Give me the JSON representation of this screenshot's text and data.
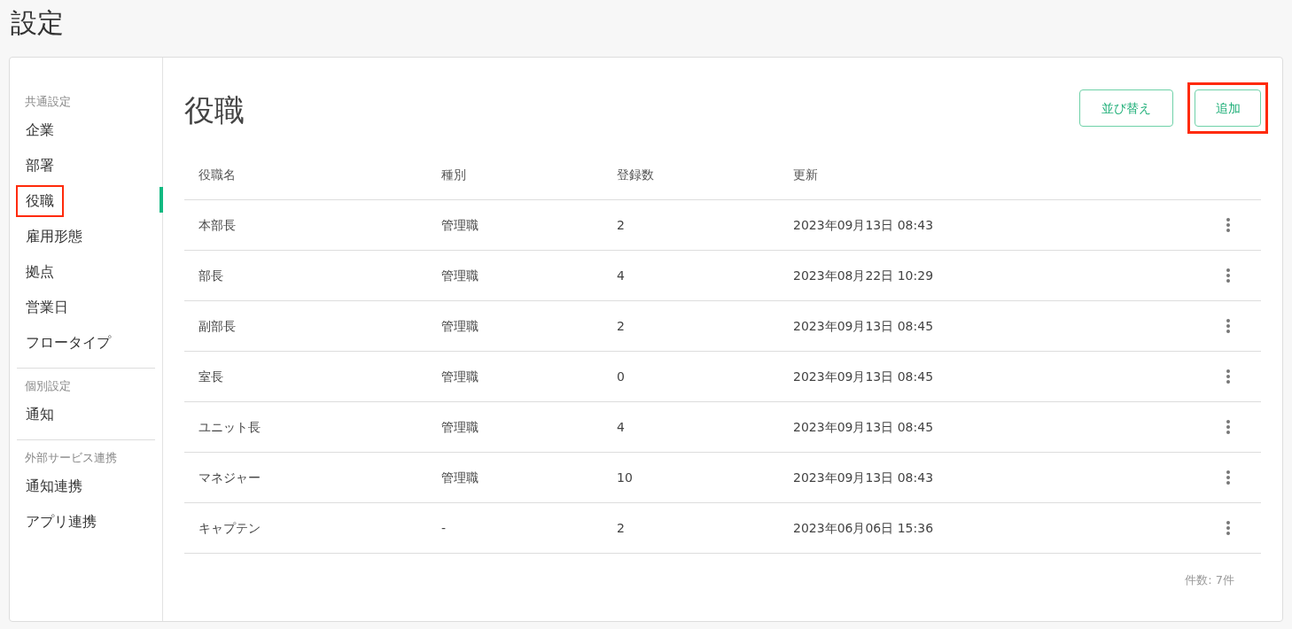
{
  "page_title": "設定",
  "sidebar": {
    "sections": [
      {
        "heading": "共通設定",
        "items": [
          {
            "label": "企業",
            "selected": false,
            "highlighted": false
          },
          {
            "label": "部署",
            "selected": false,
            "highlighted": false
          },
          {
            "label": "役職",
            "selected": true,
            "highlighted": true
          },
          {
            "label": "雇用形態",
            "selected": false,
            "highlighted": false
          },
          {
            "label": "拠点",
            "selected": false,
            "highlighted": false
          },
          {
            "label": "営業日",
            "selected": false,
            "highlighted": false
          },
          {
            "label": "フロータイプ",
            "selected": false,
            "highlighted": false
          }
        ]
      },
      {
        "heading": "個別設定",
        "items": [
          {
            "label": "通知",
            "selected": false,
            "highlighted": false
          }
        ]
      },
      {
        "heading": "外部サービス連携",
        "items": [
          {
            "label": "通知連携",
            "selected": false,
            "highlighted": false
          },
          {
            "label": "アプリ連携",
            "selected": false,
            "highlighted": false
          }
        ]
      }
    ]
  },
  "content": {
    "title": "役職",
    "buttons": [
      {
        "label": "並び替え",
        "highlighted": false
      },
      {
        "label": "追加",
        "highlighted": true
      }
    ],
    "table": {
      "columns": [
        "役職名",
        "種別",
        "登録数",
        "更新"
      ],
      "rows": [
        [
          "本部長",
          "管理職",
          "2",
          "2023年09月13日 08:43"
        ],
        [
          "部長",
          "管理職",
          "4",
          "2023年08月22日 10:29"
        ],
        [
          "副部長",
          "管理職",
          "2",
          "2023年09月13日 08:45"
        ],
        [
          "室長",
          "管理職",
          "0",
          "2023年09月13日 08:45"
        ],
        [
          "ユニット長",
          "管理職",
          "4",
          "2023年09月13日 08:45"
        ],
        [
          "マネジャー",
          "管理職",
          "10",
          "2023年09月13日 08:43"
        ],
        [
          "キャプテン",
          "-",
          "2",
          "2023年06月06日 15:36"
        ]
      ]
    },
    "count": "件数: 7件"
  }
}
